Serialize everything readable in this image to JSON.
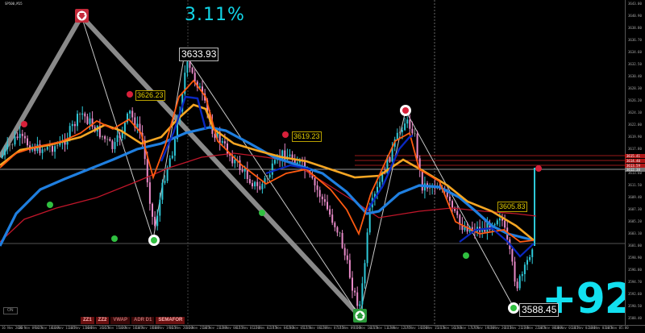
{
  "window": {
    "symbol": "SP500,M15"
  },
  "overlay": {
    "percent_change": "3.11%",
    "points_change": "+92"
  },
  "price_labels": {
    "top_high": "3633.93",
    "bottom_low": "3588.45"
  },
  "fractal_labels": {
    "a": "3626.23",
    "b": "3619.23",
    "c": "3605.83"
  },
  "toolbar": {
    "buttons": [
      "ZZ1",
      "ZZ2",
      "VWAP",
      "ADR D1",
      "SEMAFOR"
    ]
  },
  "on_button": "ON",
  "yaxis": {
    "ticks": [
      "3643.00",
      "3640.90",
      "3638.80",
      "3636.70",
      "3634.60",
      "3632.50",
      "3630.40",
      "3628.30",
      "3626.20",
      "3624.10",
      "3622.00",
      "3619.90",
      "3617.80",
      "3615.70",
      "3613.60",
      "3611.50",
      "3609.40",
      "3607.30",
      "3605.20",
      "3603.10",
      "3601.00",
      "3598.90",
      "3596.80",
      "3594.70",
      "3592.60",
      "3590.50",
      "3588.40"
    ],
    "current_price": "3612.38",
    "level_labels": [
      "3615.41",
      "3614.40",
      "3613.59"
    ]
  },
  "xaxis": {
    "ticks": [
      "16 Nov 2020",
      "16 Nov 09:15",
      "16 Nov 10:30",
      "16 Nov 11:45",
      "16 Nov 13:00",
      "16 Nov 14:15",
      "16 Nov 15:30",
      "16 Nov 16:45",
      "16 Nov 18:00",
      "16 Nov 19:15",
      "16 Nov 20:30",
      "16 Nov 21:45",
      "16 Nov 23:00",
      "17 Nov 00:15",
      "17 Nov 01:30",
      "17 Nov 02:45",
      "17 Nov 04:00",
      "17 Nov 05:15",
      "17 Nov 06:30",
      "17 Nov 07:45",
      "17 Nov 09:00",
      "17 Nov 10:15",
      "17 Nov 11:30",
      "17 Nov 12:45",
      "17 Nov 14:00",
      "17 Nov 15:15",
      "17 Nov 16:30",
      "17 Nov 17:45",
      "17 Nov 19:00",
      "17 Nov 20:15",
      "17 Nov 21:30",
      "17 Nov 22:45",
      "18 Nov 00:00",
      "18 Nov 01:15",
      "18 Nov 02:30",
      "18 Nov 03:45",
      "18 Nov 05:00"
    ]
  },
  "colors": {
    "bull": "#2ec8d8",
    "bear": "#e88ac8",
    "neutral": "#888888",
    "ma_orange": "#f5a623",
    "ma_dark_orange": "#ff5a10",
    "ma_blue": "#1f7fe0",
    "ma_navy": "#0a28c0",
    "ma_red": "#c0162a",
    "zigzag_thick": "#8a8a8a",
    "zigzag_thin": "#c8c8c8",
    "dot_red": "#d8203a",
    "dot_green": "#30c040"
  }
}
